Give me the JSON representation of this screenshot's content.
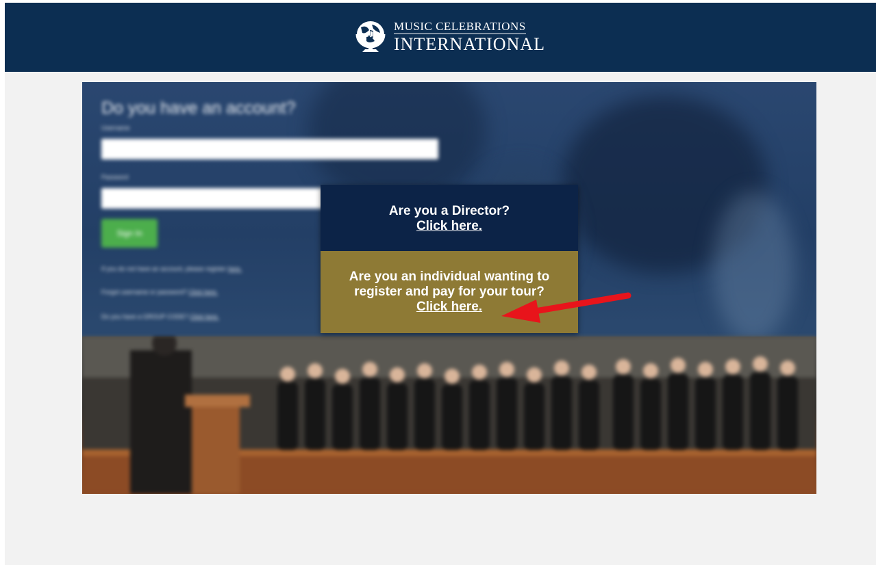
{
  "brand": {
    "line1": "MUSIC CELEBRATIONS",
    "line2": "INTERNATIONAL"
  },
  "login": {
    "title": "Do you have an account?",
    "username_label": "Username",
    "password_label": "Password",
    "username_value": "",
    "password_value": "",
    "signin_label": "Sign In",
    "register_text": "If you do not have an account, please register",
    "register_link": "here.",
    "forgot_text": "Forgot username or password?",
    "forgot_link": "Click here.",
    "group_text": "Do you have a GROUP CODE?",
    "group_link": "Click here."
  },
  "modal": {
    "director_question": "Are you a Director?",
    "director_link": "Click here.",
    "individual_question_line1": "Are you an individual wanting to",
    "individual_question_line2": "register and pay for your tour?",
    "individual_link": "Click here."
  },
  "colors": {
    "header_bg": "#0c2e52",
    "director_bg": "#0c2347",
    "individual_bg": "#8e7a35",
    "signin_bg": "#4cae4c",
    "arrow": "#e8141b"
  }
}
